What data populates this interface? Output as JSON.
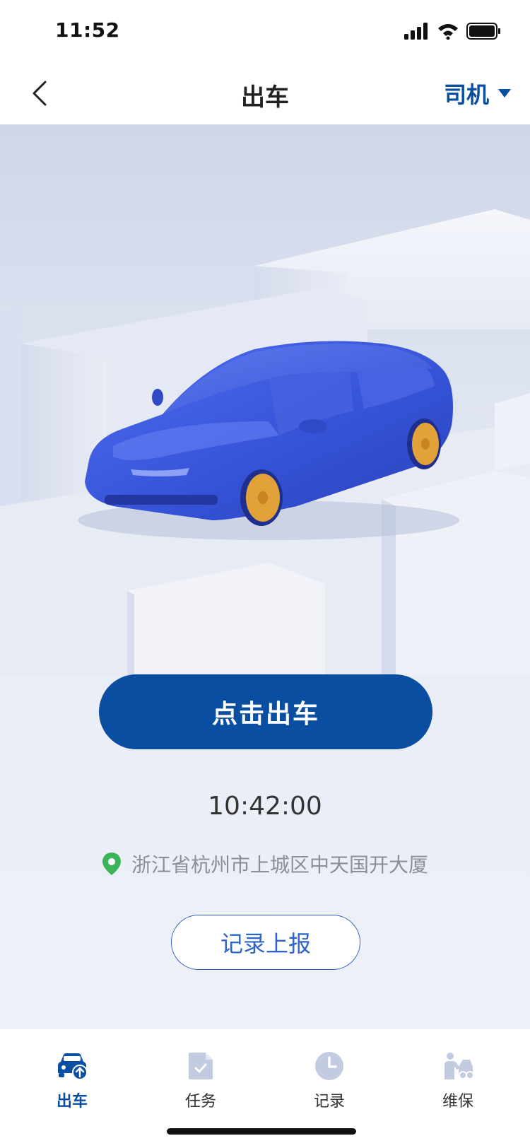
{
  "status_bar": {
    "time": "11:52"
  },
  "nav": {
    "title": "出车",
    "role": "司机"
  },
  "action": {
    "depart_label": "点击出车"
  },
  "clock": {
    "time": "10:42:00"
  },
  "location": {
    "address": "浙江省杭州市上城区中天国开大厦"
  },
  "report": {
    "label": "记录上报"
  },
  "tabs": [
    {
      "label": "出车",
      "icon": "car-depart-icon",
      "active": true
    },
    {
      "label": "任务",
      "icon": "task-doc-icon",
      "active": false
    },
    {
      "label": "记录",
      "icon": "clock-icon",
      "active": false
    },
    {
      "label": "维保",
      "icon": "maintenance-icon",
      "active": false
    }
  ],
  "colors": {
    "primary": "#0a4ea1",
    "outline": "#2e63c7",
    "car_body": "#3b56d9",
    "wheel": "#e3a13a",
    "pin": "#3cb45a",
    "tab_inactive": "#c3cbe0"
  }
}
